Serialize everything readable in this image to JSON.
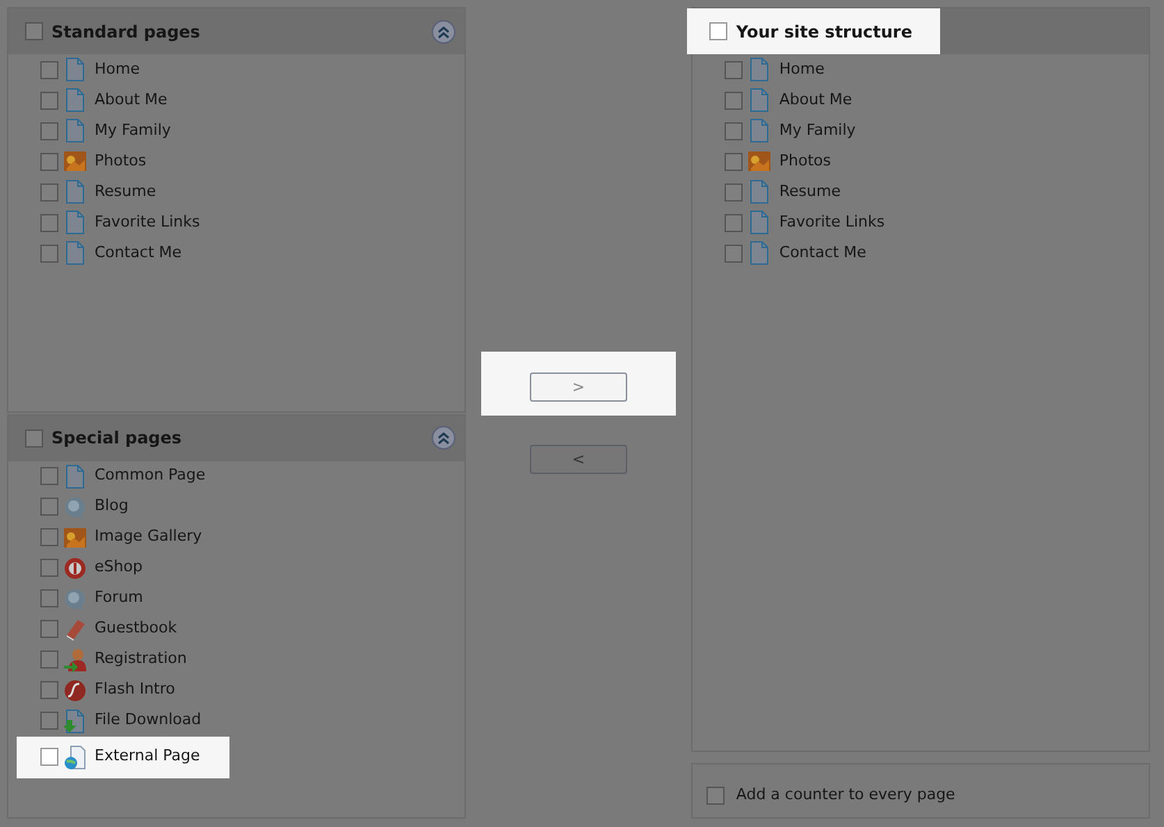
{
  "standard_pages": {
    "title": "Standard pages",
    "checked": false,
    "highlighted": false,
    "items": [
      {
        "label": "Home",
        "kind": "page",
        "checked": false,
        "highlighted": false
      },
      {
        "label": "About Me",
        "kind": "page",
        "checked": false,
        "highlighted": false
      },
      {
        "label": "My Family",
        "kind": "page",
        "checked": false,
        "highlighted": false
      },
      {
        "label": "Photos",
        "kind": "photo",
        "checked": false,
        "highlighted": false
      },
      {
        "label": "Resume",
        "kind": "page",
        "checked": false,
        "highlighted": false
      },
      {
        "label": "Favorite Links",
        "kind": "page",
        "checked": false,
        "highlighted": false
      },
      {
        "label": "Contact Me",
        "kind": "page",
        "checked": false,
        "highlighted": false
      }
    ]
  },
  "special_pages": {
    "title": "Special pages",
    "checked": false,
    "highlighted": false,
    "items": [
      {
        "label": "Common Page",
        "kind": "page",
        "checked": false,
        "highlighted": false
      },
      {
        "label": "Blog",
        "kind": "blog",
        "checked": false,
        "highlighted": false
      },
      {
        "label": "Image Gallery",
        "kind": "photo",
        "checked": false,
        "highlighted": false
      },
      {
        "label": "eShop",
        "kind": "eshop",
        "checked": false,
        "highlighted": false
      },
      {
        "label": "Forum",
        "kind": "forum",
        "checked": false,
        "highlighted": false
      },
      {
        "label": "Guestbook",
        "kind": "guestbook",
        "checked": false,
        "highlighted": false
      },
      {
        "label": "Registration",
        "kind": "registration",
        "checked": false,
        "highlighted": false
      },
      {
        "label": "Flash Intro",
        "kind": "flash",
        "checked": false,
        "highlighted": false
      },
      {
        "label": "File Download",
        "kind": "download",
        "checked": false,
        "highlighted": false
      },
      {
        "label": "External Page",
        "kind": "external",
        "checked": false,
        "highlighted": true
      }
    ]
  },
  "move_buttons": [
    {
      "label": ">",
      "highlighted": true
    },
    {
      "label": "<",
      "highlighted": false
    }
  ],
  "site_structure": {
    "title": "Your site structure",
    "checked": false,
    "highlighted": true,
    "items": [
      {
        "label": "Home",
        "kind": "page",
        "checked": false,
        "highlighted": false
      },
      {
        "label": "About Me",
        "kind": "page",
        "checked": false,
        "highlighted": false
      },
      {
        "label": "My Family",
        "kind": "page",
        "checked": false,
        "highlighted": false
      },
      {
        "label": "Photos",
        "kind": "photo",
        "checked": false,
        "highlighted": false
      },
      {
        "label": "Resume",
        "kind": "page",
        "checked": false,
        "highlighted": false
      },
      {
        "label": "Favorite Links",
        "kind": "page",
        "checked": false,
        "highlighted": false
      },
      {
        "label": "Contact Me",
        "kind": "page",
        "checked": false,
        "highlighted": false
      }
    ]
  },
  "counter_option": {
    "label": "Add a counter to every page",
    "checked": false,
    "highlighted": false
  }
}
